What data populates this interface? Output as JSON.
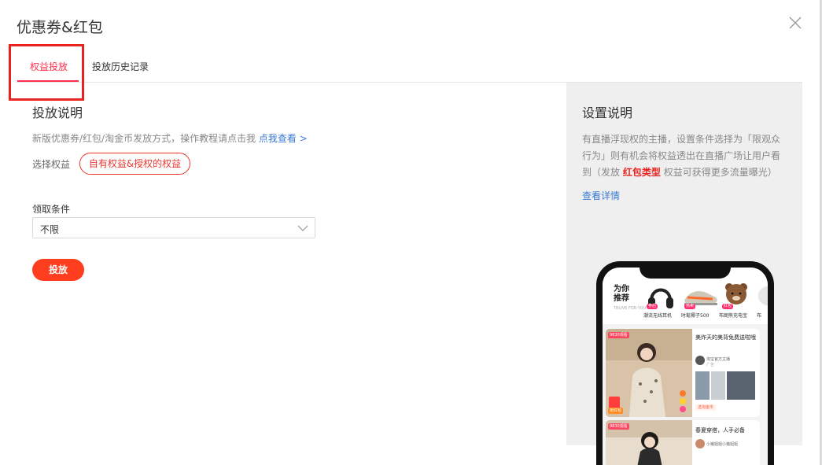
{
  "modal": {
    "title": "优惠券&红包"
  },
  "tabs": [
    {
      "label": "权益投放",
      "active": true
    },
    {
      "label": "投放历史记录",
      "active": false
    }
  ],
  "main": {
    "section_title": "投放说明",
    "description": "新版优惠券/红包/淘金币发放方式，操作教程请点击我",
    "description_link": "点我查看 >",
    "select_label": "选择权益",
    "benefit_pill": "自有权益&授权的权益",
    "condition_label": "领取条件",
    "condition_value": "不限",
    "release_button": "投放"
  },
  "side_panel": {
    "title": "设置说明",
    "text_part1": "有直播浮现权的主播，设置条件选择为「限观众行为」则有机会将权益透出在直播广场让用户看到（发放",
    "text_red": "红包类型",
    "text_part2": "权益可获得更多流量曝光）",
    "link": "查看详情"
  },
  "phone": {
    "rec_head_1": "为你",
    "rec_head_2": "推荐",
    "rec_sub": "TBLIVE FOR YOU",
    "rec_items": [
      {
        "name": "潮流无线耳机",
        "tag": "券后"
      },
      {
        "name": "时髦椰子500",
        "tag": "热卖"
      },
      {
        "name": "布朗熊充电宝",
        "tag": "红包"
      },
      {
        "name": "布"
      }
    ],
    "card1": {
      "live_badge": "9830观看",
      "title": "美炸天的美背免费送啦哦",
      "host": "淘宝官方主播",
      "host_sub": "广告",
      "coupon": "送淘金币",
      "red_packet": "抢红包"
    },
    "card2": {
      "live_badge": "9830观看",
      "title": "春夏穿搭，人手必备",
      "host": "小猪姐姐小猪姐姐"
    }
  },
  "colors": {
    "accent_red": "#ff2e4d",
    "button_orange": "#ff3d1f",
    "link_blue": "#3a7bd5",
    "highlight_red": "#e8231f"
  }
}
